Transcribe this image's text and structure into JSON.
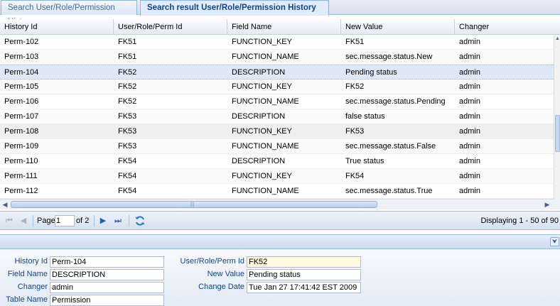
{
  "tabs": [
    {
      "label": "Search User/Role/Permission History",
      "active": false
    },
    {
      "label": "Search result User/Role/Permission History",
      "active": true
    }
  ],
  "grid": {
    "columns": [
      "History Id",
      "User/Role/Perm Id",
      "Field Name",
      "New Value",
      "Changer"
    ],
    "rows": [
      [
        "Perm-102",
        "FK51",
        "FUNCTION_KEY",
        "FK51",
        "admin"
      ],
      [
        "Perm-103",
        "FK51",
        "FUNCTION_NAME",
        "sec.message.status.New",
        "admin"
      ],
      [
        "Perm-104",
        "FK52",
        "DESCRIPTION",
        "Pending status",
        "admin"
      ],
      [
        "Perm-105",
        "FK52",
        "FUNCTION_KEY",
        "FK52",
        "admin"
      ],
      [
        "Perm-106",
        "FK52",
        "FUNCTION_NAME",
        "sec.message.status.Pending",
        "admin"
      ],
      [
        "Perm-107",
        "FK53",
        "DESCRIPTION",
        "false status",
        "admin"
      ],
      [
        "Perm-108",
        "FK53",
        "FUNCTION_KEY",
        "FK53",
        "admin"
      ],
      [
        "Perm-109",
        "FK53",
        "FUNCTION_NAME",
        "sec.message.status.False",
        "admin"
      ],
      [
        "Perm-110",
        "FK54",
        "DESCRIPTION",
        "True status",
        "admin"
      ],
      [
        "Perm-111",
        "FK54",
        "FUNCTION_KEY",
        "FK54",
        "admin"
      ],
      [
        "Perm-112",
        "FK54",
        "FUNCTION_NAME",
        "sec.message.status.True",
        "admin"
      ]
    ],
    "selected_row": "Perm-104",
    "hover_row": "Perm-108"
  },
  "pager": {
    "page_label": "Page",
    "page_value": "1",
    "of_label": "of 2",
    "display_text": "Displaying 1 - 50 of 90",
    "icons": {
      "first": "first-page-icon",
      "prev": "prev-page-icon",
      "next": "next-page-icon",
      "last": "last-page-icon",
      "refresh": "refresh-icon"
    }
  },
  "detail": {
    "collapse_icon": "collapse-chevron-icon",
    "history_id_label": "History Id",
    "history_id_value": "Perm-104",
    "field_name_label": "Field Name",
    "field_name_value": "DESCRIPTION",
    "changer_label": "Changer",
    "changer_value": "admin",
    "table_name_label": "Table Name",
    "table_name_value": "Permission",
    "perm_id_label": "User/Role/Perm Id",
    "perm_id_value": "FK52",
    "new_value_label": "New Value",
    "new_value_value": "Pending status",
    "change_date_label": "Change Date",
    "change_date_value": "Tue Jan 27 17:41:42 EST 2009"
  },
  "colors": {
    "selected_row": "#dfe8f6",
    "header_text": "#15428b",
    "border": "#99bbe8"
  }
}
